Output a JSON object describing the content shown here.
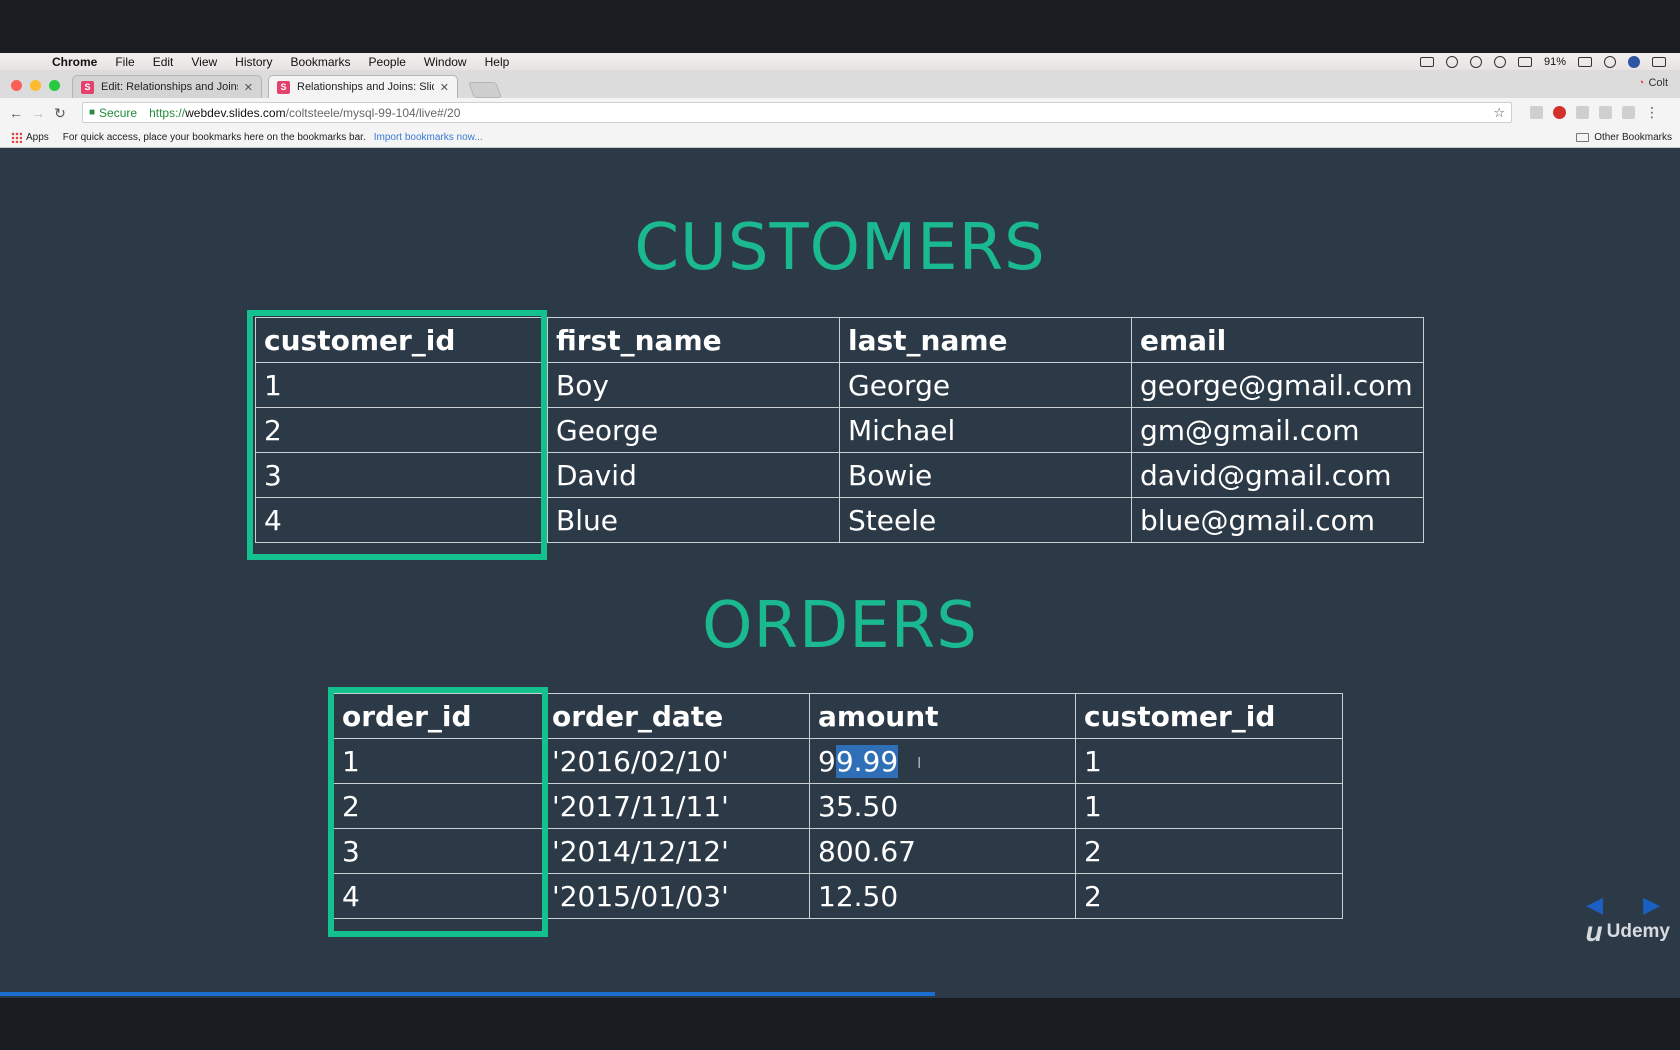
{
  "menubar": {
    "items": [
      "Chrome",
      "File",
      "Edit",
      "View",
      "History",
      "Bookmarks",
      "People",
      "Window",
      "Help"
    ],
    "battery": "91%"
  },
  "tabs": [
    {
      "label": "Edit: Relationships and Joins",
      "favicon": "S"
    },
    {
      "label": "Relationships and Joins: Slides",
      "favicon": "S"
    }
  ],
  "profile_name": "Colt",
  "address": {
    "secure_label": "Secure",
    "scheme": "https://",
    "host": "webdev.slides.com",
    "path": "/coltsteele/mysql-99-104/live#/20"
  },
  "bookmarks": {
    "apps": "Apps",
    "hint": "For quick access, place your bookmarks here on the bookmarks bar.",
    "import_link": "Import bookmarks now...",
    "other": "Other Bookmarks"
  },
  "slide": {
    "customers_title": "CUSTOMERS",
    "customers_headers": [
      "customer_id",
      "first_name",
      "last_name",
      "email"
    ],
    "customers_rows": [
      [
        "1",
        "Boy",
        "George",
        "george@gmail.com"
      ],
      [
        "2",
        "George",
        "Michael",
        "gm@gmail.com"
      ],
      [
        "3",
        "David",
        "Bowie",
        "david@gmail.com"
      ],
      [
        "4",
        "Blue",
        "Steele",
        "blue@gmail.com"
      ]
    ],
    "orders_title": "ORDERS",
    "orders_headers": [
      "order_id",
      "order_date",
      "amount",
      "customer_id"
    ],
    "orders_rows": [
      [
        "1",
        "'2016/02/10'",
        "99.99",
        "1"
      ],
      [
        "2",
        "'2017/11/11'",
        "35.50",
        "1"
      ],
      [
        "3",
        "'2014/12/12'",
        "800.67",
        "2"
      ],
      [
        "4",
        "'2015/01/03'",
        "12.50",
        "2"
      ]
    ],
    "selection": {
      "row": 0,
      "col": 2,
      "prefix": "9",
      "selected": "9.99"
    }
  },
  "branding": {
    "logo_text": "Udemy"
  },
  "colors": {
    "accent": "#1bb98f",
    "highlight_box": "#13c08e",
    "slide_bg": "#2c3a47"
  }
}
